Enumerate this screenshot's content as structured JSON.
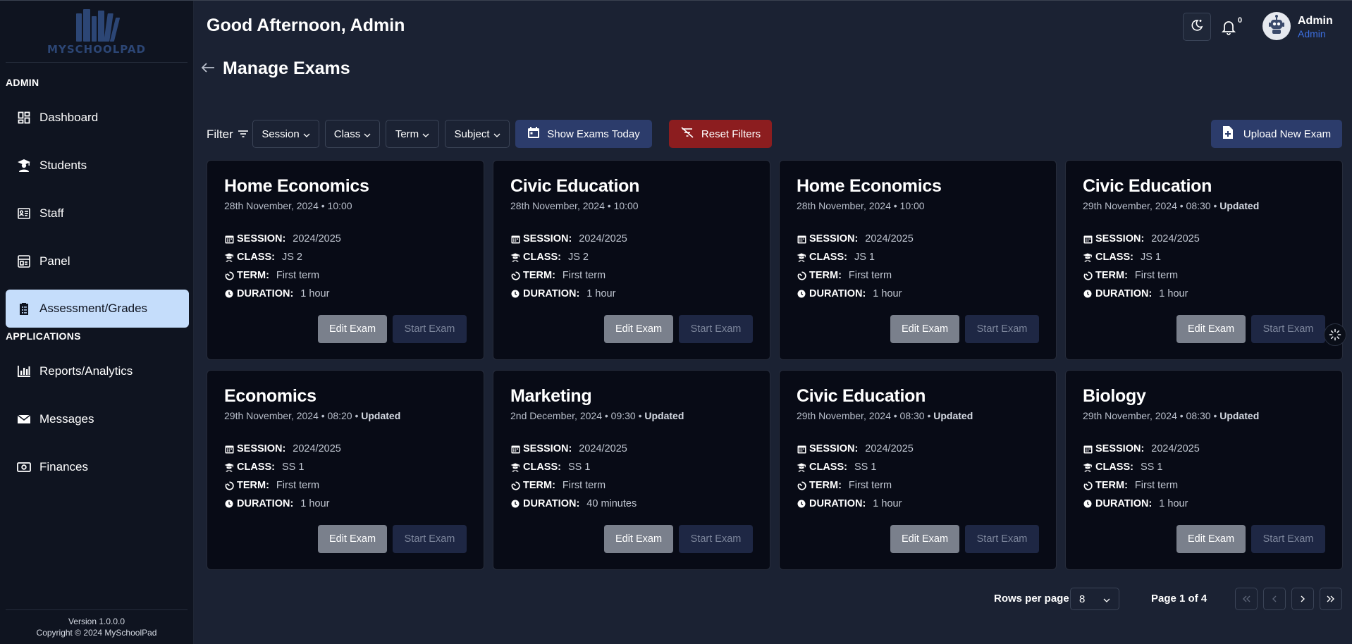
{
  "brand": {
    "logo_text": "MYSCHOOLPAD"
  },
  "sidebar": {
    "section_admin": "ADMIN",
    "section_apps": "APPLICATIONS",
    "items": [
      {
        "label": "Dashboard",
        "icon": "dashboard-icon"
      },
      {
        "label": "Students",
        "icon": "student-icon"
      },
      {
        "label": "Staff",
        "icon": "staff-icon"
      },
      {
        "label": "Panel",
        "icon": "panel-icon"
      },
      {
        "label": "Assessment/Grades",
        "icon": "clipboard-icon",
        "active": true
      },
      {
        "label": "Reports/Analytics",
        "icon": "chart-icon"
      },
      {
        "label": "Messages",
        "icon": "envelope-icon"
      },
      {
        "label": "Finances",
        "icon": "money-icon"
      }
    ],
    "version": "Version 1.0.0.0",
    "copyright": "Copyright © 2024 MySchoolPad"
  },
  "header": {
    "greeting": "Good Afternoon, Admin",
    "notification_count": "0",
    "user_name": "Admin",
    "user_role": "Admin"
  },
  "page": {
    "title": "Manage Exams"
  },
  "filters": {
    "label": "Filter",
    "session": "Session",
    "class": "Class",
    "term": "Term",
    "subject": "Subject",
    "show_today": "Show Exams Today",
    "reset": "Reset Filters",
    "upload": "Upload New Exam"
  },
  "field_labels": {
    "session": "SESSION:",
    "class": "CLASS:",
    "term": "TERM:",
    "duration": "DURATION:"
  },
  "buttons": {
    "edit": "Edit Exam",
    "start": "Start Exam"
  },
  "exams": [
    {
      "subject": "Home Economics",
      "date": "28th November, 2024 • 10:00",
      "updated": "",
      "session": "2024/2025",
      "class": "JS 2",
      "term": "First term",
      "duration": "1 hour"
    },
    {
      "subject": "Civic Education",
      "date": "28th November, 2024 • 10:00",
      "updated": "",
      "session": "2024/2025",
      "class": "JS 2",
      "term": "First term",
      "duration": "1 hour"
    },
    {
      "subject": "Home Economics",
      "date": "28th November, 2024 • 10:00",
      "updated": "",
      "session": "2024/2025",
      "class": "JS 1",
      "term": "First term",
      "duration": "1 hour"
    },
    {
      "subject": "Civic Education",
      "date": "29th November, 2024 • 08:30 •",
      "updated": "Updated",
      "session": "2024/2025",
      "class": "JS 1",
      "term": "First term",
      "duration": "1 hour"
    },
    {
      "subject": "Economics",
      "date": "29th November, 2024 • 08:20 •",
      "updated": "Updated",
      "session": "2024/2025",
      "class": "SS 1",
      "term": "First term",
      "duration": "1 hour"
    },
    {
      "subject": "Marketing",
      "date": "2nd December, 2024 • 09:30 •",
      "updated": "Updated",
      "session": "2024/2025",
      "class": "SS 1",
      "term": "First term",
      "duration": "40 minutes"
    },
    {
      "subject": "Civic Education",
      "date": "29th November, 2024 • 08:30 •",
      "updated": "Updated",
      "session": "2024/2025",
      "class": "SS 1",
      "term": "First term",
      "duration": "1 hour"
    },
    {
      "subject": "Biology",
      "date": "29th November, 2024 • 08:30 •",
      "updated": "Updated",
      "session": "2024/2025",
      "class": "SS 1",
      "term": "First term",
      "duration": "1 hour"
    }
  ],
  "pagination": {
    "rows_label": "Rows per page",
    "rows_value": "8",
    "page_info": "Page 1 of 4"
  },
  "colors": {
    "background": "#1b2233",
    "sidebar": "#0f1420",
    "card": "#080b16",
    "active_nav": "#c5ddfb",
    "primary_button": "#2c3c6b",
    "danger_button": "#8c1d1f",
    "role_text": "#3d6fe0"
  }
}
